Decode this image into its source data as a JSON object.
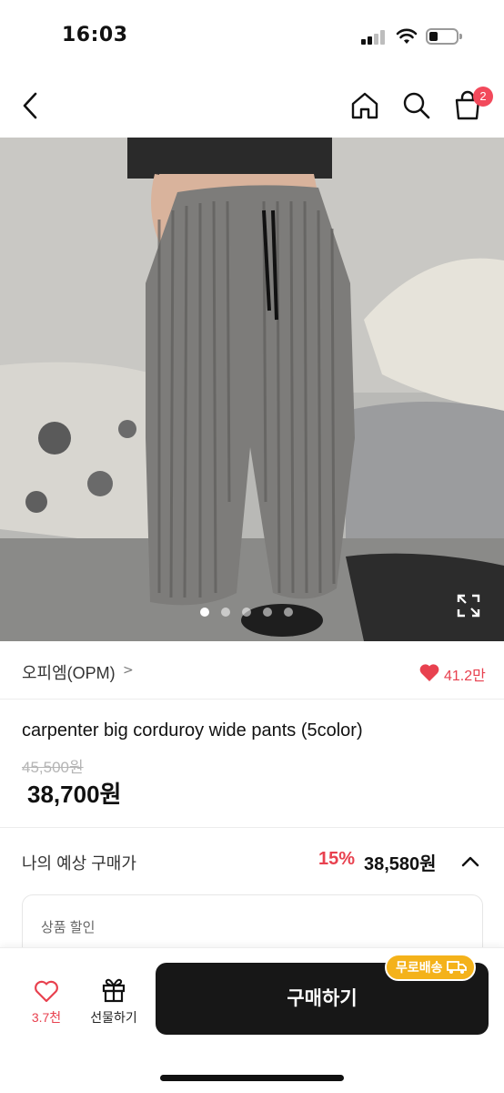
{
  "status_bar": {
    "time": "16:03"
  },
  "nav": {
    "cart_count": "2"
  },
  "brand": {
    "name": "오피엠(OPM)",
    "chevron": ">",
    "likes": "41.2만"
  },
  "product": {
    "title": "carpenter big corduroy wide pants (5color)",
    "original_price": "45,500원",
    "sale_price": "38,700원"
  },
  "expected": {
    "label": "나의 예상 구매가",
    "rate": "15%",
    "price": "38,580원"
  },
  "discount_card": {
    "label": "상품 할인"
  },
  "carousel": {
    "slide_count": 5,
    "active_index": 0
  },
  "bottom_bar": {
    "wishlist_count": "3.7천",
    "gift_label": "선물하기",
    "buy_label": "구매하기",
    "free_shipping": "무로배송"
  },
  "colors": {
    "accent_red": "#e8414f",
    "badge_yellow": "#f4b21a",
    "buy_button": "#171717"
  }
}
